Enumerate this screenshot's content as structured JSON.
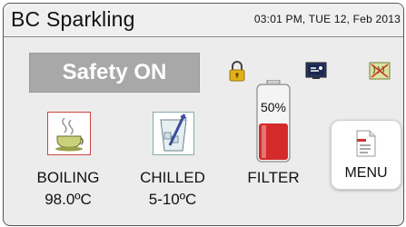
{
  "header": {
    "title": "BC Sparkling",
    "datetime": "03:01 PM, TUE 12, Feb 2013"
  },
  "status": {
    "safety_label": "Safety ON",
    "icons": [
      "lock-icon",
      "display-icon",
      "heater-off-icon"
    ]
  },
  "tiles": [
    {
      "name": "BOILING",
      "value": "98.0ºC",
      "icon": "boiling-cup-icon"
    },
    {
      "name": "CHILLED",
      "value": "5-10ºC",
      "icon": "chilled-glass-icon"
    }
  ],
  "filter": {
    "label": "FILTER",
    "percent_text": "50%",
    "level": 0.5,
    "icon": "battery-icon"
  },
  "menu": {
    "label": "MENU",
    "icon": "document-icon"
  },
  "colors": {
    "safety_bg": "#a8a8a8",
    "filter_fill": "#d42a2a",
    "lock": "#e2b11a"
  }
}
